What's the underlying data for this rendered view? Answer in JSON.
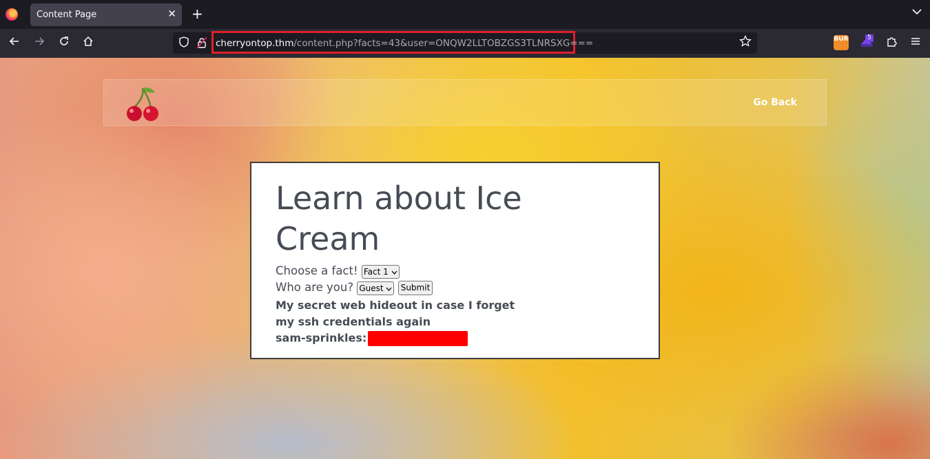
{
  "browser": {
    "tab_title": "Content Page",
    "tab_close": "✕",
    "new_tab": "+",
    "tab_list": "⌄",
    "url_host": "cherryontop.thm",
    "url_path": "/content.php?facts=43&user=ONQW2LLTOBZGS3TLNRSXG===",
    "extensions": [
      {
        "name": "burp-extension-icon",
        "label": "BUR"
      },
      {
        "name": "hacker-hat-extension-icon",
        "badge": "5"
      }
    ],
    "accent": "#e0202a"
  },
  "page": {
    "nav_link": "Go Back",
    "heading": "Learn about Ice Cream",
    "fact_label": "Choose a fact!",
    "fact_selected": "Fact 1",
    "user_label": "Who are you?",
    "user_selected": "Guest",
    "submit_label": "Submit",
    "secret_text": "My secret web hideout in case I forget my ssh credentials again",
    "cred_user": "sam-sprinkles:",
    "redaction_color": "#ff0000"
  }
}
